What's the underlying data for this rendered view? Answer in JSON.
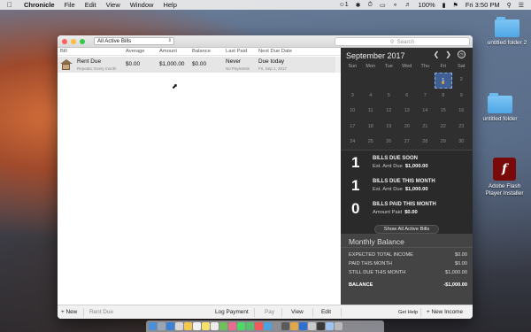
{
  "menubar": {
    "app_name": "Chronicle",
    "items": [
      "File",
      "Edit",
      "View",
      "Window",
      "Help"
    ],
    "status_badge": "1",
    "battery": "100%",
    "clock": "Fri 3:50 PM"
  },
  "desktop": {
    "icons": [
      {
        "label": "untitled folder 2"
      },
      {
        "label": "untitled folder"
      },
      {
        "label": "Adobe Flash Player Installer"
      }
    ]
  },
  "window": {
    "filter_select": "All Active Bills",
    "search_placeholder": "Search",
    "columns": [
      "Bill",
      "Average",
      "Amount",
      "Balance",
      "Last Paid",
      "Next Due Date"
    ],
    "bills": [
      {
        "name": "Rent Due",
        "repeat": "Repeats: Every month",
        "average": "$0.00",
        "amount": "$1,000.00",
        "balance": "$0.00",
        "last_paid": "Never",
        "last_paid_sub": "No Payments",
        "next_due": "Due today",
        "next_due_sub": "Fri, Sep 1, 2017"
      }
    ]
  },
  "calendar": {
    "month_title": "September 2017",
    "weekdays": [
      "Sun",
      "Mon",
      "Tue",
      "Wed",
      "Thu",
      "Fri",
      "Sat"
    ],
    "selected_day": "1",
    "weeks": [
      [
        "",
        "",
        "",
        "",
        "",
        "1",
        "2"
      ],
      [
        "3",
        "4",
        "5",
        "6",
        "7",
        "8",
        "9"
      ],
      [
        "10",
        "11",
        "12",
        "13",
        "14",
        "15",
        "16"
      ],
      [
        "17",
        "18",
        "19",
        "20",
        "21",
        "22",
        "23"
      ],
      [
        "24",
        "25",
        "26",
        "27",
        "28",
        "29",
        "30"
      ]
    ]
  },
  "summary": {
    "due_soon": {
      "count": "1",
      "title": "BILLS DUE SOON",
      "label": "Est. Amt Due",
      "amount": "$1,000.00"
    },
    "due_month": {
      "count": "1",
      "title": "BILLS DUE THIS MONTH",
      "label": "Est. Amt Due",
      "amount": "$1,000.00"
    },
    "paid_month": {
      "count": "0",
      "title": "BILLS PAID THIS MONTH",
      "label": "Amount Paid",
      "amount": "$0.00"
    },
    "show_all_label": "Show All Active Bills"
  },
  "monthly_balance": {
    "title": "Monthly Balance",
    "rows": [
      {
        "label": "EXPECTED TOTAL INCOME",
        "value": "$0.00"
      },
      {
        "label": "PAID THIS MONTH",
        "value": "$0.00"
      },
      {
        "label": "STILL DUE THIS MONTH",
        "value": "$1,000.00"
      },
      {
        "label": "BALANCE",
        "value": "-$1,000.00"
      }
    ]
  },
  "toolbar": {
    "new_label": "+ New",
    "selected_bill": "Rent Due",
    "log_payment": "Log Payment",
    "pay": "Pay",
    "view": "View",
    "edit": "Edit",
    "get_help": "Get Help",
    "new_income": "+ New Income"
  },
  "colors": {
    "accent_selection": "#3f5f95",
    "dot": "#e6a92b",
    "panel_dark": "#2f2f2f"
  }
}
